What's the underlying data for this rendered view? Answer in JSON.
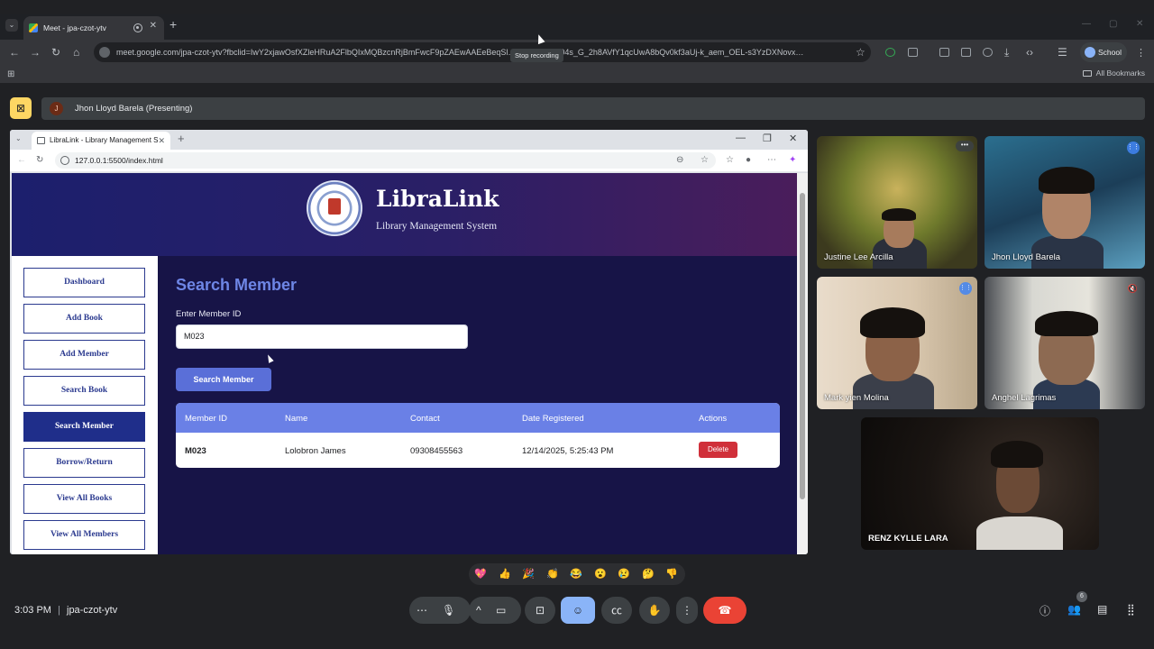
{
  "outer_browser": {
    "tab_title": "Meet - jpa-czot-ytv",
    "url": "meet.google.com/jpa-czot-ytv?fbclid=IwY2xjawOsfXZleHRuA2FlbQIxMQBzcnRjBmFwcF9pZAEwAAEeBeqSl…AIFUbc-1ZZ04s_G_2h8AVfY1qcUwA8bQv0kf3aUj-k_aem_OEL-s3YzDXNovx…",
    "tooltip": "Stop recording",
    "profile_label": "School",
    "bookmarks_label": "All Bookmarks"
  },
  "meet": {
    "presenter_initial": "J",
    "presenting_label": "Jhon Lloyd Barela (Presenting)",
    "time": "3:03 PM",
    "separator": "|",
    "meeting_code": "jpa-czot-ytv",
    "participants_count": "6",
    "participants": [
      {
        "name": "Justine Lee Arcilla"
      },
      {
        "name": "Jhon Lloyd Barela"
      },
      {
        "name": "Mark yien Molina"
      },
      {
        "name": "Anghel Lagrimas"
      },
      {
        "name": "RENZ KYLLE LARA"
      }
    ],
    "reactions": [
      "💖",
      "👍",
      "🎉",
      "👏",
      "😂",
      "😮",
      "😢",
      "🤔",
      "👎"
    ]
  },
  "inner_browser": {
    "tab_title": "LibraLink - Library Management S",
    "url": "127.0.0.1:5500/index.html"
  },
  "app": {
    "brand": "LibraLink",
    "tagline": "Library Management System",
    "nav": [
      {
        "label": "Dashboard"
      },
      {
        "label": "Add Book"
      },
      {
        "label": "Add Member"
      },
      {
        "label": "Search Book"
      },
      {
        "label": "Search Member",
        "active": true
      },
      {
        "label": "Borrow/Return"
      },
      {
        "label": "View All Books"
      },
      {
        "label": "View All Members"
      }
    ],
    "page_title": "Search Member",
    "field_label": "Enter Member ID",
    "member_id_value": "M023",
    "search_button": "Search Member",
    "table": {
      "headers": [
        "Member ID",
        "Name",
        "Contact",
        "Date Registered",
        "Actions"
      ],
      "rows": [
        {
          "member_id": "M023",
          "name": "Lolobron James",
          "contact": "09308455563",
          "date_registered": "12/14/2025, 5:25:43 PM",
          "action": "Delete"
        }
      ]
    }
  },
  "colors": {
    "app_background": "#171447",
    "accent": "#6a80e6",
    "nav_active": "#1f2e8a",
    "delete": "#d0303a",
    "end_call": "#ea4335"
  }
}
